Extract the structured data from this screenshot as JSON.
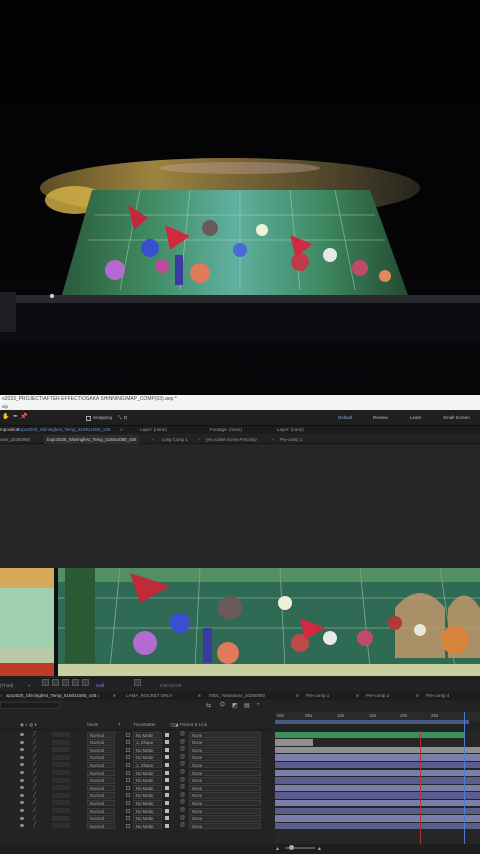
{
  "app": {
    "title_path": "o2023_PROJECT\\AFTER EFFECT\\OSAKA SHINNING\\MAP_COMP(03).aep *",
    "menu_text": "elp"
  },
  "toolbar": {
    "snapping_label": "Snapping",
    "workspaces": [
      "Default",
      "Review",
      "Learn",
      "Small Screen"
    ]
  },
  "panels": {
    "composition_prefix": "mposition",
    "composition_name": "Expo2025_Shiningfest_Temp_5160x1080_v28",
    "layer_tab": "Layer: (none)",
    "footage_tab": "Footage: (none)",
    "layer2_tab": "Layer: (none)"
  },
  "flowchart": {
    "items": [
      "ome_20250900",
      "Expo2025_Shiningfest_Temp_5160x1080_v28",
      "Long Comp 1",
      "yes rocket scene Precomp",
      "Pre-comp 1"
    ],
    "separators": [
      "<",
      "<",
      "<"
    ]
  },
  "transport": {
    "zoom": "(Third)",
    "view_percent": "Half",
    "timecode": "0:00:02:00"
  },
  "timeline": {
    "tabs": [
      "xpo2025_Shiningfest_Temp_5160x1080_v28",
      "LAMA_ROCKET ONLY",
      "0001_Yasinanno_20250900",
      "Pre-comp 1",
      "Pre-comp 2",
      "Pre-comp 4"
    ],
    "columns": {
      "mode": "Mode",
      "t": "T",
      "trkmat": "TrackMatte",
      "parent": "Parent & Link"
    },
    "ruler_labels": [
      "00s",
      "05s",
      "10s",
      "15s",
      "20s",
      "25s"
    ],
    "layers": [
      {
        "mode": "Normal",
        "trkmat": "No Matte",
        "parent": "None"
      },
      {
        "mode": "Normal",
        "trkmat": "1. Shape",
        "parent": "None"
      },
      {
        "mode": "Normal",
        "trkmat": "No Matte",
        "parent": "None"
      },
      {
        "mode": "Normal",
        "trkmat": "No Matte",
        "parent": "None"
      },
      {
        "mode": "Normal",
        "trkmat": "1. Shape",
        "parent": "None"
      },
      {
        "mode": "Normal",
        "trkmat": "No Matte",
        "parent": "None"
      },
      {
        "mode": "Normal",
        "trkmat": "No Matte",
        "parent": "None"
      },
      {
        "mode": "Normal",
        "trkmat": "No Matte",
        "parent": "None"
      },
      {
        "mode": "Normal",
        "trkmat": "No Matte",
        "parent": "None"
      },
      {
        "mode": "Normal",
        "trkmat": "No Matte",
        "parent": "None"
      },
      {
        "mode": "Normal",
        "trkmat": "No Matte",
        "parent": "None"
      },
      {
        "mode": "Normal",
        "trkmat": "No Matte",
        "parent": "None"
      },
      {
        "mode": "Normal",
        "trkmat": "No Matte",
        "parent": "None"
      }
    ],
    "bar_colors": {
      "first": "#3b8f5a",
      "gray": "#8f8f8f",
      "purple": "#5a5e8f",
      "lavender": "#7a7ea8"
    }
  },
  "colors": {
    "accent": "#6f8fd0",
    "playhead": "#4a7bd0",
    "panel_bg": "#232323",
    "title_bg": "#f4f4f4"
  }
}
